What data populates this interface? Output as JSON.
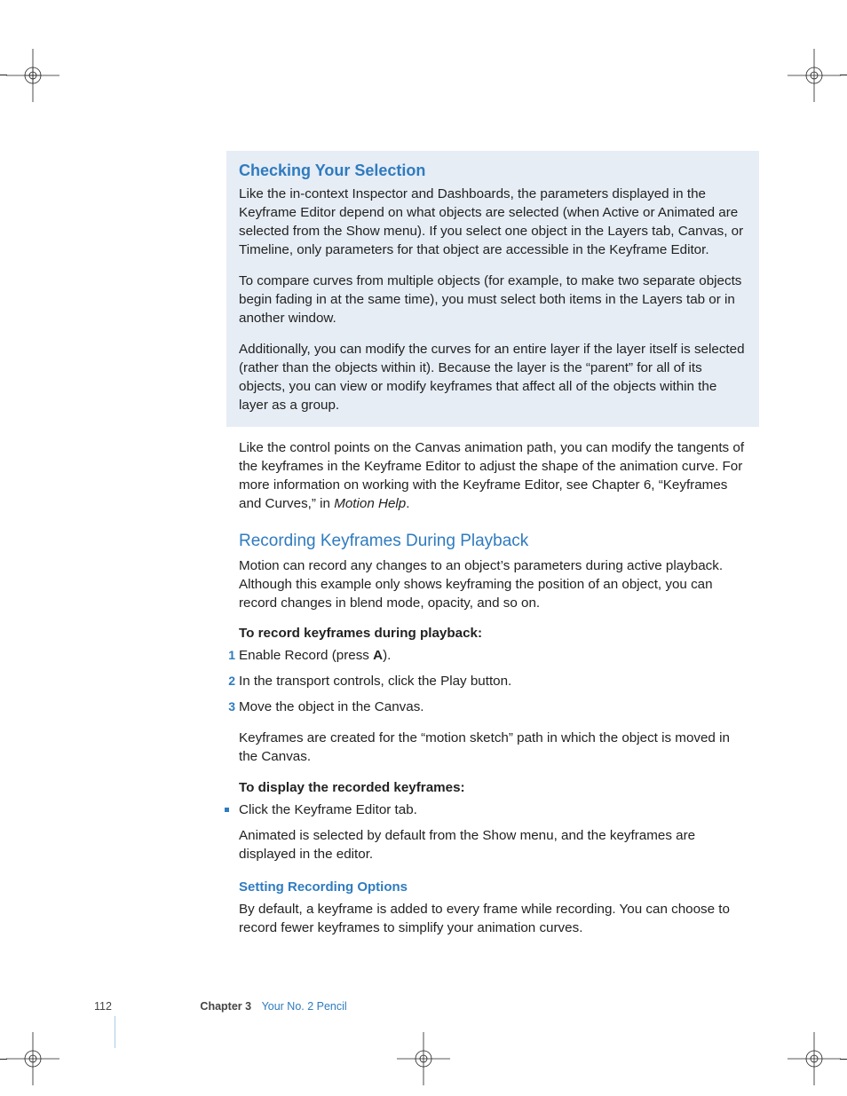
{
  "box": {
    "heading": "Checking Your Selection",
    "p1": "Like the in-context Inspector and Dashboards, the parameters displayed in the Keyframe Editor depend on what objects are selected (when Active or Animated are selected from the Show menu). If you select one object in the Layers tab, Canvas, or Timeline, only parameters for that object are accessible in the Keyframe Editor.",
    "p2": "To compare curves from multiple objects (for example, to make two separate objects begin fading in at the same time), you must select both items in the Layers tab or in another window.",
    "p3": "Additionally, you can modify the curves for an entire layer if the layer itself is selected (rather than the objects within it). Because the layer is the “parent” for all of its objects, you can view or modify keyframes that affect all of the objects within the layer as a group."
  },
  "after_box_a": "Like the control points on the Canvas animation path, you can modify the tangents of the keyframes in the Keyframe Editor to adjust the shape of the animation curve. For more information on working with the Keyframe Editor, see Chapter 6, “Keyframes and Curves,” in ",
  "after_box_em": "Motion Help",
  "after_box_b": ".",
  "section2": {
    "heading": "Recording Keyframes During Playback",
    "lead": "Motion can record any changes to an object’s parameters during active playback. Although this example only shows keyframing the position of an object, you can record changes in blend mode, opacity, and so on.",
    "howto1_title": "To record keyframes during playback:",
    "steps_pre": "Enable Record (press ",
    "steps_key": "A",
    "steps_post": ").",
    "step2": "In the transport controls, click the Play button.",
    "step3": "Move the object in the Canvas.",
    "after_steps": "Keyframes are created for the “motion sketch” path in which the object is moved in the Canvas.",
    "howto2_title": "To display the recorded keyframes:",
    "bullet1": "Click the Keyframe Editor tab.",
    "after_bullet": "Animated is selected by default from the Show menu, and the keyframes are displayed in the editor."
  },
  "sub": {
    "heading": "Setting Recording Options",
    "p": "By default, a keyframe is added to every frame while recording. You can choose to record fewer keyframes to simplify your animation curves."
  },
  "footer": {
    "page": "112",
    "chapter_label": "Chapter 3",
    "chapter_title": "Your No. 2 Pencil"
  },
  "nums": {
    "n1": "1",
    "n2": "2",
    "n3": "3"
  }
}
